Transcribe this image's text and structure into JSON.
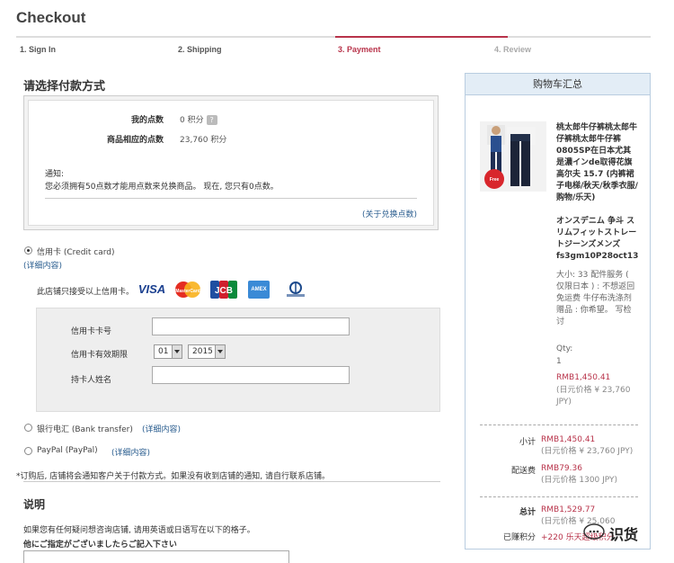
{
  "page": {
    "title": "Checkout"
  },
  "steps": [
    {
      "label": "1. Sign In"
    },
    {
      "label": "2. Shipping"
    },
    {
      "label": "3. Payment"
    },
    {
      "label": "4. Review"
    }
  ],
  "payment": {
    "title": "请选择付款方式",
    "points": {
      "my_points_label": "我的点数",
      "my_points_value": "0 积分",
      "product_points_label": "商品相应的点数",
      "product_points_value": "23,760 积分",
      "notice_label": "通知:",
      "notice_text": "您必须拥有50点数才能用点数来兑换商品。 现在, 您只有0点数。",
      "exchange_link": "(关于兑换点数)"
    },
    "credit_card": {
      "label": "信用卡 (Credit card)",
      "details_link": "(详细内容)",
      "accepted_label": "此店铺只接受以上信用卡。",
      "logos": [
        "VISA",
        "MasterCard",
        "JCB",
        "AMEX",
        "Diners Club"
      ],
      "form": {
        "number_label": "信用卡卡号",
        "number_value": "",
        "expiry_label": "信用卡有效期限",
        "expiry_month": "01",
        "expiry_year": "2015",
        "holder_label": "持卡人姓名",
        "holder_value": ""
      }
    },
    "bank_transfer": {
      "label": "银行电汇 (Bank transfer)",
      "details_link": "(详细内容)"
    },
    "paypal": {
      "label": "PayPal (PayPal)",
      "details_link": "(详细内容)"
    },
    "footnote": "*订购后, 店铺将会通知客户关于付款方式。如果没有收到店铺的通知, 请自行联系店铺。"
  },
  "notes": {
    "title": "说明",
    "line1": "如果您有任何疑问想咨询店铺, 请用英语或日语写在以下的格子。",
    "line2": "他にご指定がございましたらご記入下さい"
  },
  "cart": {
    "title": "购物车汇总",
    "product_name": "桃太郎牛仔裤桃太郎牛仔裤桃太郎牛仔裤0805SP在日本尤其是濃インde取得花旗高尔夫 15.7 (内裤裙子电梯/秋天/秋季衣服/购物/乐天)",
    "product_name_jp": "オンスデニム 争斗 スリムフィットストレートジーンズメンズ fs3gm10P28oct13",
    "size_info": "大小: 33 配件服务 ( 仅限日本 ) : 不想返回免运费 牛仔布洗涤剂 赠品 : 你希望。 写检讨",
    "qty_label": "Qty:",
    "qty_value": "1",
    "price": "RMB1,450.41",
    "price_jpy": "(日元价格 ¥ 23,760 JPY)",
    "subtotal_label": "小计",
    "subtotal_value": "RMB1,450.41",
    "subtotal_jpy": "(日元价格 ¥ 23,760 JPY)",
    "shipping_label": "配送费",
    "shipping_value": "RMB79.36",
    "shipping_jpy": "(日元价格 1300 JPY)",
    "total_label": "总计",
    "total_value": "RMB1,529.77",
    "total_jpy": "(日元价格 ¥ 25,060",
    "earned_label": "已赚积分",
    "earned_value": "+220 乐天超级积分"
  },
  "watermark": {
    "text": "识货"
  },
  "colors": {
    "accent": "#b8334a",
    "link": "#2a5d8f",
    "cart_header": "#e3edf6"
  }
}
